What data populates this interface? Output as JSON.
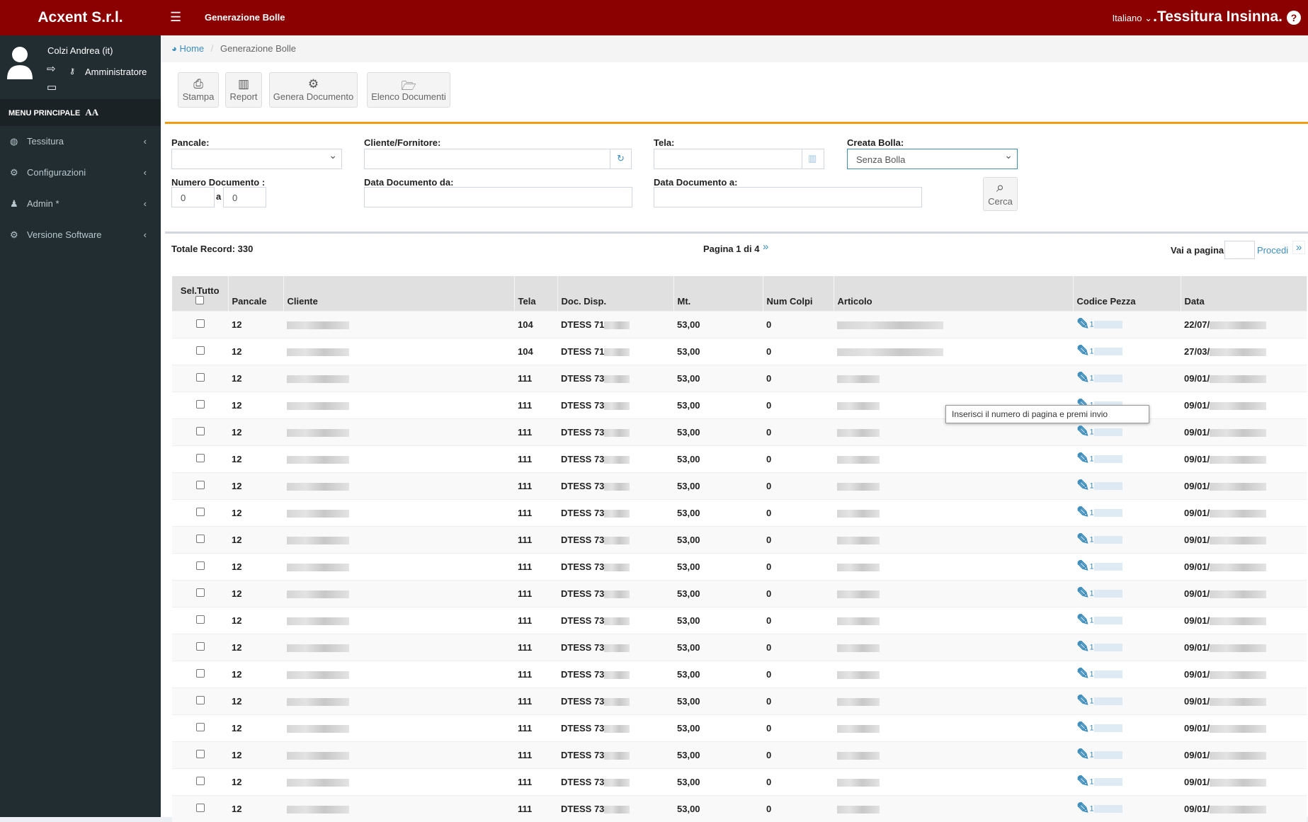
{
  "header": {
    "brand": "Acxent S.r.l.",
    "page_title": "Generazione Bolle",
    "language": "Italiano",
    "company": ".Tessitura Insinna.",
    "help": "?"
  },
  "user": {
    "name": "Colzi Andrea (it)",
    "role": "Amministratore"
  },
  "sidebar": {
    "heading": "MENU PRINCIPALE",
    "font_toggle": "AA",
    "items": [
      {
        "label": "Tessitura",
        "icon": "globe-icon"
      },
      {
        "label": "Configurazioni",
        "icon": "cogs-icon"
      },
      {
        "label": "Admin *",
        "icon": "user-secret-icon"
      },
      {
        "label": "Versione Software",
        "icon": "cogs-icon"
      }
    ]
  },
  "breadcrumb": {
    "home": "Home",
    "current": "Generazione Bolle"
  },
  "toolbar": {
    "stampa": "Stampa",
    "report": "Report",
    "genera": "Genera Documento",
    "elenco": "Elenco Documenti"
  },
  "filters": {
    "pancale_label": "Pancale:",
    "pancale_value": "",
    "cliente_label": "Cliente/Fornitore:",
    "cliente_value": "",
    "tela_label": "Tela:",
    "tela_value": "",
    "creata_label": "Creata Bolla:",
    "creata_value": "Senza Bolla",
    "numdoc_label": "Numero Documento :",
    "numdoc_from": "0",
    "numdoc_sep": "a",
    "numdoc_to": "0",
    "data_da_label": "Data Documento da:",
    "data_a_label": "Data Documento a:",
    "cerca": "Cerca"
  },
  "pagination": {
    "total": "Totale Record: 330",
    "page": "Pagina 1 di 4",
    "goto_label": "Vai a pagina",
    "goto_value": "",
    "procedi": "Procedi",
    "tooltip": "Inserisci il numero di pagina e premi invio"
  },
  "table": {
    "columns": [
      "Sel.Tutto",
      "Pancale",
      "Cliente",
      "Tela",
      "Doc. Disp.",
      "Mt.",
      "Num Colpi",
      "Articolo",
      "Codice Pezza",
      "Data"
    ],
    "rows": [
      {
        "pancale": "12",
        "tela": "104",
        "doc": "DTESS 71",
        "mt": "53,00",
        "colpi": "0",
        "codice": "1",
        "data": "22/07/"
      },
      {
        "pancale": "12",
        "tela": "104",
        "doc": "DTESS 71",
        "mt": "53,00",
        "colpi": "0",
        "codice": "1",
        "data": "27/03/"
      },
      {
        "pancale": "12",
        "tela": "111",
        "doc": "DTESS 73",
        "mt": "53,00",
        "colpi": "0",
        "codice": "1",
        "data": "09/01/"
      },
      {
        "pancale": "12",
        "tela": "111",
        "doc": "DTESS 73",
        "mt": "53,00",
        "colpi": "0",
        "codice": "1",
        "data": "09/01/"
      },
      {
        "pancale": "12",
        "tela": "111",
        "doc": "DTESS 73",
        "mt": "53,00",
        "colpi": "0",
        "codice": "1",
        "data": "09/01/"
      },
      {
        "pancale": "12",
        "tela": "111",
        "doc": "DTESS 73",
        "mt": "53,00",
        "colpi": "0",
        "codice": "1",
        "data": "09/01/"
      },
      {
        "pancale": "12",
        "tela": "111",
        "doc": "DTESS 73",
        "mt": "53,00",
        "colpi": "0",
        "codice": "1",
        "data": "09/01/"
      },
      {
        "pancale": "12",
        "tela": "111",
        "doc": "DTESS 73",
        "mt": "53,00",
        "colpi": "0",
        "codice": "1",
        "data": "09/01/"
      },
      {
        "pancale": "12",
        "tela": "111",
        "doc": "DTESS 73",
        "mt": "53,00",
        "colpi": "0",
        "codice": "1",
        "data": "09/01/"
      },
      {
        "pancale": "12",
        "tela": "111",
        "doc": "DTESS 73",
        "mt": "53,00",
        "colpi": "0",
        "codice": "1",
        "data": "09/01/"
      },
      {
        "pancale": "12",
        "tela": "111",
        "doc": "DTESS 73",
        "mt": "53,00",
        "colpi": "0",
        "codice": "1",
        "data": "09/01/"
      },
      {
        "pancale": "12",
        "tela": "111",
        "doc": "DTESS 73",
        "mt": "53,00",
        "colpi": "0",
        "codice": "1",
        "data": "09/01/"
      },
      {
        "pancale": "12",
        "tela": "111",
        "doc": "DTESS 73",
        "mt": "53,00",
        "colpi": "0",
        "codice": "1",
        "data": "09/01/"
      },
      {
        "pancale": "12",
        "tela": "111",
        "doc": "DTESS 73",
        "mt": "53,00",
        "colpi": "0",
        "codice": "1",
        "data": "09/01/"
      },
      {
        "pancale": "12",
        "tela": "111",
        "doc": "DTESS 73",
        "mt": "53,00",
        "colpi": "0",
        "codice": "1",
        "data": "09/01/"
      },
      {
        "pancale": "12",
        "tela": "111",
        "doc": "DTESS 73",
        "mt": "53,00",
        "colpi": "0",
        "codice": "1",
        "data": "09/01/"
      },
      {
        "pancale": "12",
        "tela": "111",
        "doc": "DTESS 73",
        "mt": "53,00",
        "colpi": "0",
        "codice": "1",
        "data": "09/01/"
      },
      {
        "pancale": "12",
        "tela": "111",
        "doc": "DTESS 73",
        "mt": "53,00",
        "colpi": "0",
        "codice": "1",
        "data": "09/01/"
      },
      {
        "pancale": "12",
        "tela": "111",
        "doc": "DTESS 73",
        "mt": "53,00",
        "colpi": "0",
        "codice": "1",
        "data": "09/01/"
      }
    ]
  },
  "colors": {
    "header": "#8b0000",
    "sidebar": "#222d32",
    "accent": "#f39c12",
    "link": "#3c8dbc"
  }
}
